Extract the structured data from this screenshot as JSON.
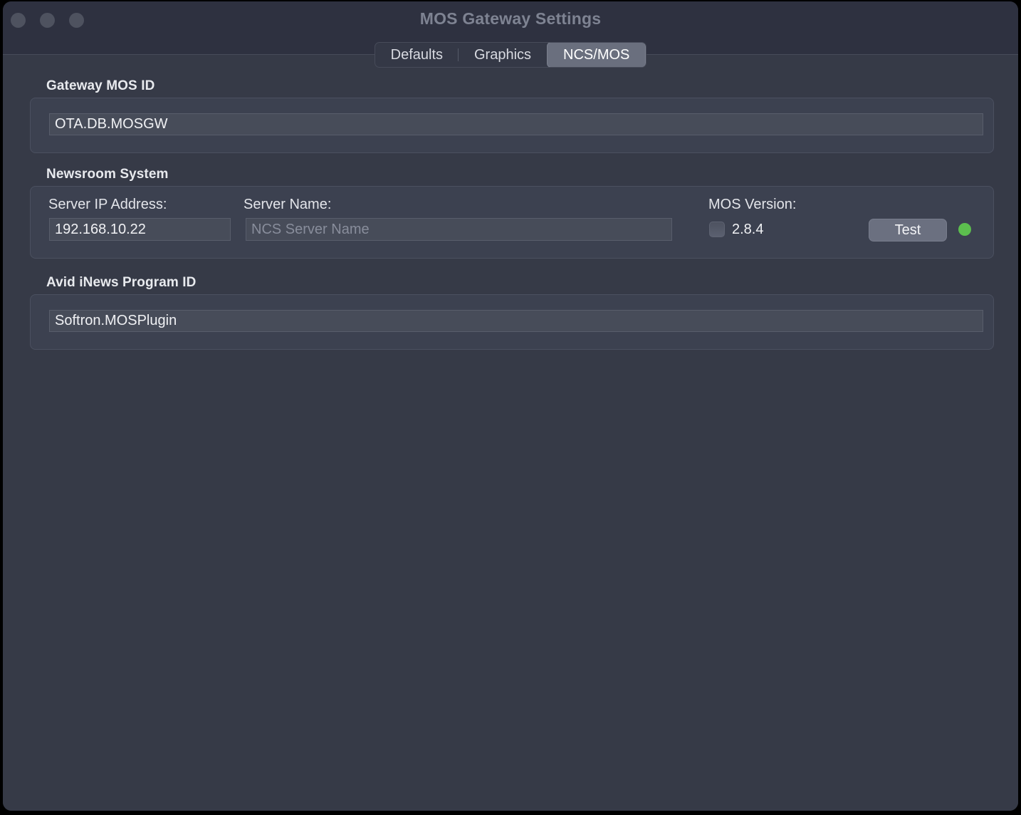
{
  "window": {
    "title": "MOS Gateway Settings",
    "traffic_lights": [
      "close",
      "minimize",
      "zoom"
    ],
    "accent_green": "#5cbe4e",
    "background": "#363a47",
    "titlebar_background": "#2e3140"
  },
  "tabs": [
    {
      "label": "Defaults",
      "active": false
    },
    {
      "label": "Graphics",
      "active": false
    },
    {
      "label": "NCS/MOS",
      "active": true
    }
  ],
  "sections": {
    "gateway_mos_id": {
      "label": "Gateway MOS ID",
      "field_value": "OTA.DB.MOSGW",
      "field_placeholder": "Gateway MOS ID"
    },
    "newsroom_system": {
      "label": "Newsroom System",
      "server_ip_label": "Server IP Address:",
      "server_ip_value": "192.168.10.22",
      "server_ip_placeholder": "Server IP Address",
      "server_name_label": "Server Name:",
      "server_name_value": "",
      "server_name_placeholder": "NCS Server Name",
      "mos_version_label": "MOS Version:",
      "mos_version_checkbox_label": "2.8.4",
      "mos_version_checked": false,
      "test_button_label": "Test",
      "status_led_color": "#5cbe4e"
    },
    "avid_inews_program_id": {
      "label": "Avid iNews Program ID",
      "field_value": "Softron.MOSPlugin",
      "field_placeholder": "Avid iNews Program ID"
    }
  }
}
